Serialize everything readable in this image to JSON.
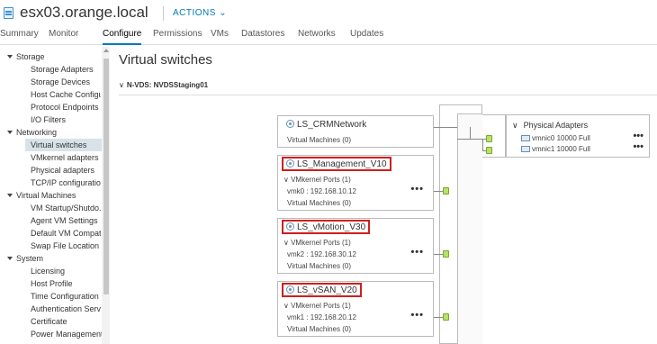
{
  "header": {
    "host_icon": "host-icon",
    "host_name": "esx03.orange.local",
    "actions_label": "ACTIONS ⌄"
  },
  "tabs": [
    {
      "label": "Summary"
    },
    {
      "label": "Monitor"
    },
    {
      "label": "Configure",
      "active": true
    },
    {
      "label": "Permissions"
    },
    {
      "label": "VMs"
    },
    {
      "label": "Datastores"
    },
    {
      "label": "Networks"
    },
    {
      "label": "Updates"
    }
  ],
  "sidebar": {
    "items": [
      {
        "label": "Storage",
        "group": true
      },
      {
        "label": "Storage Adapters"
      },
      {
        "label": "Storage Devices"
      },
      {
        "label": "Host Cache Configur..."
      },
      {
        "label": "Protocol Endpoints"
      },
      {
        "label": "I/O Filters"
      },
      {
        "label": "Networking",
        "group": true
      },
      {
        "label": "Virtual switches",
        "selected": true
      },
      {
        "label": "VMkernel adapters"
      },
      {
        "label": "Physical adapters"
      },
      {
        "label": "TCP/IP configuration"
      },
      {
        "label": "Virtual Machines",
        "group": true
      },
      {
        "label": "VM Startup/Shutdo..."
      },
      {
        "label": "Agent VM Settings"
      },
      {
        "label": "Default VM Compati..."
      },
      {
        "label": "Swap File Location"
      },
      {
        "label": "System",
        "group": true
      },
      {
        "label": "Licensing"
      },
      {
        "label": "Host Profile"
      },
      {
        "label": "Time Configuration"
      },
      {
        "label": "Authentication Servi..."
      },
      {
        "label": "Certificate"
      },
      {
        "label": "Power Management"
      }
    ]
  },
  "main": {
    "title": "Virtual switches",
    "nvds_chevron": "∨",
    "nvds_label": "N-VDS: NVDSStaging01",
    "switches": [
      {
        "name": "LS_CRMNetwork",
        "highlight": false,
        "vm_line": "Virtual Machines (0)"
      },
      {
        "name": "LS_Management_V10",
        "highlight": true,
        "ports_label": "∨ VMkernel Ports (1)",
        "vmk_line": "vmk0 : 192.168.10.12",
        "vm_line": "Virtual Machines (0)"
      },
      {
        "name": "LS_vMotion_V30",
        "highlight": true,
        "ports_label": "∨ VMkernel Ports (1)",
        "vmk_line": "vmk2 : 192.168.30.12",
        "vm_line": "Virtual Machines (0)"
      },
      {
        "name": "LS_vSAN_V20",
        "highlight": true,
        "ports_label": "∨ VMkernel Ports (1)",
        "vmk_line": "vmk1 : 192.168.20.12",
        "vm_line": "Virtual Machines (0)"
      }
    ],
    "more_icon": "•••",
    "physical": {
      "chevron": "∨",
      "title": "Physical Adapters",
      "nics": [
        {
          "label": "vmnic0 10000 Full"
        },
        {
          "label": "vmnic1 10000 Full"
        }
      ]
    }
  },
  "colors": {
    "accent": "#0079b8",
    "highlight_border": "#d11e1e",
    "port_green": "#b8e06a"
  }
}
